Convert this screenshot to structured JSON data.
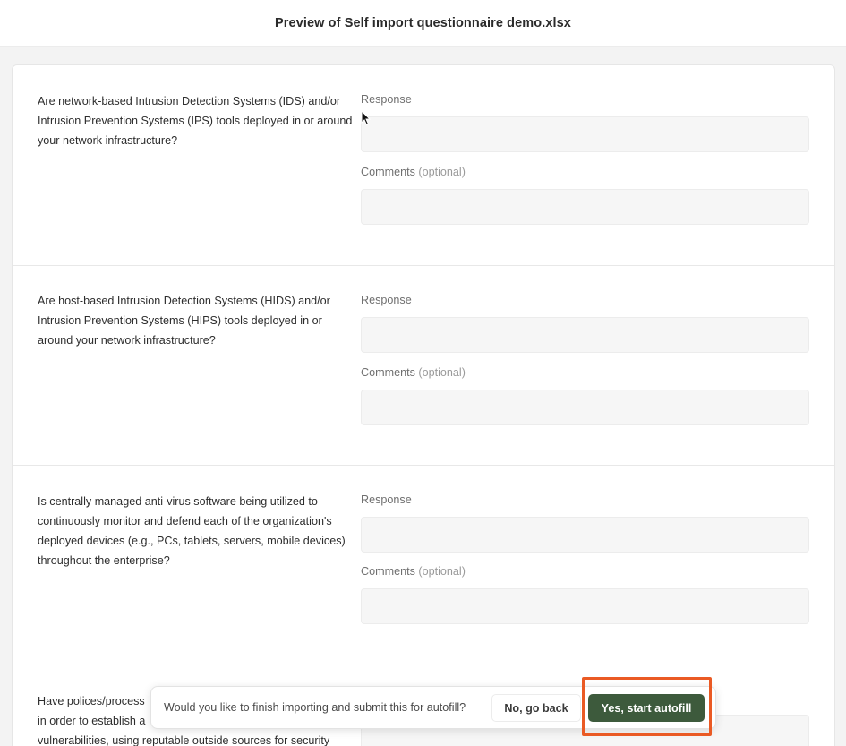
{
  "header": {
    "title": "Preview of Self import questionnaire demo.xlsx"
  },
  "questions": [
    {
      "text": "Are network-based Intrusion Detection Systems (IDS) and/or Intrusion Prevention Systems (IPS) tools deployed in or around your network infrastructure?",
      "response_label": "Response",
      "response_value": "",
      "comments_label": "Comments",
      "comments_optional": "(optional)",
      "comments_value": ""
    },
    {
      "text": "Are host-based Intrusion Detection Systems (HIDS) and/or Intrusion Prevention Systems (HIPS) tools deployed in or around your network infrastructure?",
      "response_label": "Response",
      "response_value": "",
      "comments_label": "Comments",
      "comments_optional": "(optional)",
      "comments_value": ""
    },
    {
      "text": "Is centrally managed anti-virus software being utilized to continuously monitor and defend each of the organization's deployed devices (e.g., PCs, tablets, servers, mobile devices) throughout the enterprise?",
      "response_label": "Response",
      "response_value": "",
      "comments_label": "Comments",
      "comments_optional": "(optional)",
      "comments_value": ""
    },
    {
      "text": "Have polices/process                                       in order to establish a                                              vulnerabilities, using reputable outside sources for security",
      "text_lines": [
        "Have polices/process",
        "in order to establish a",
        "vulnerabilities, using reputable outside sources for security"
      ],
      "response_label": "Response",
      "response_value": ""
    }
  ],
  "toast": {
    "message": "Would you like to finish importing and submit this for autofill?",
    "back_label": "No, go back",
    "confirm_label": "Yes, start autofill"
  },
  "colors": {
    "confirm_button": "#3d5a3c",
    "highlight_outline": "#ea5a24"
  }
}
